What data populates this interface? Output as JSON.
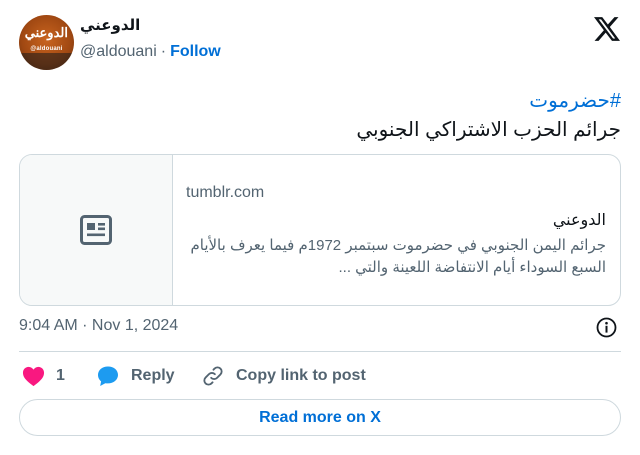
{
  "author": {
    "display_name": "الدوعني",
    "handle": "@aldouani",
    "separator": "·",
    "follow_label": "Follow",
    "avatar_logo_arabic": "الدوعني",
    "avatar_logo_latin": "@aldouani"
  },
  "tweet": {
    "hashtag": "#حضرموت",
    "body": "جرائم الحزب الاشتراكي الجنوبي"
  },
  "link_card": {
    "thumbnail_icon": "article-icon",
    "domain": "tumblr.com",
    "title": "الدوعني",
    "description": "جرائم اليمن الجنوبي في حضرموت سبتمبر 1972م فيما يعرف بالأيام السبع السوداء أيام الانتفاضة اللعينة والتي ..."
  },
  "meta": {
    "timestamp": "9:04 AM · Nov 1, 2024",
    "info_icon": "info-icon"
  },
  "actions": {
    "like_icon": "heart-icon",
    "like_count": "1",
    "reply_icon": "reply-icon",
    "reply_label": "Reply",
    "copy_icon": "link-icon",
    "copy_label": "Copy link to post"
  },
  "footer": {
    "read_more_label": "Read more on X"
  },
  "colors": {
    "accent": "#006fd6",
    "heart": "#f91880",
    "reply": "#1d9bf0",
    "secondary_text": "#536471",
    "border": "#cfd9de"
  }
}
